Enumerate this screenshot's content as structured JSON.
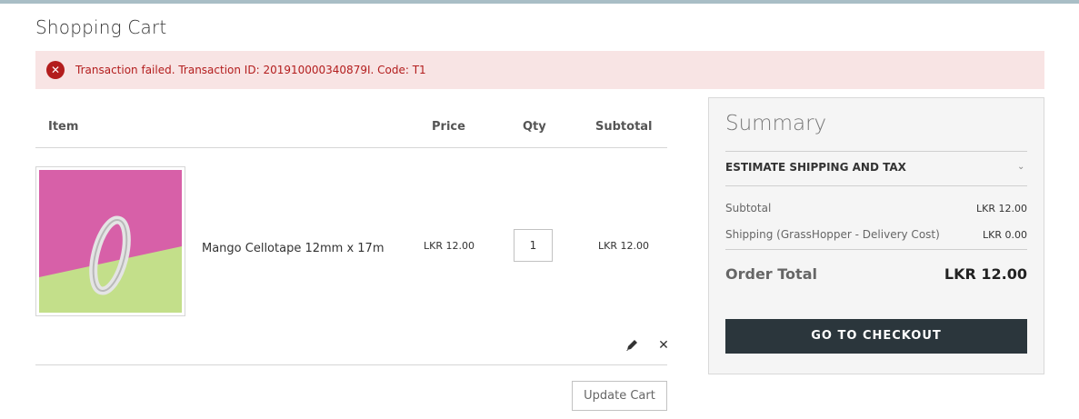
{
  "page": {
    "title": "Shopping Cart"
  },
  "alert": {
    "icon": "error-x-icon",
    "message": "Transaction failed. Transaction ID: 201910000340879I. Code: T1",
    "color": "#b31d1d",
    "background": "#f8e4e4"
  },
  "cart": {
    "columns": {
      "item": "Item",
      "price": "Price",
      "qty": "Qty",
      "subtotal": "Subtotal"
    },
    "items": [
      {
        "name": "Mango Cellotape 12mm x 17m",
        "price": "LKR 12.00",
        "qty": "1",
        "subtotal": "LKR 12.00",
        "edit_icon": "pencil-icon",
        "remove_icon": "close-icon",
        "remove_glyph": "✕"
      }
    ],
    "update_label": "Update Cart"
  },
  "summary": {
    "title": "Summary",
    "estimate_label": "ESTIMATE SHIPPING AND TAX",
    "chevron_icon": "chevron-down-icon",
    "chevron_glyph": "⌄",
    "subtotal_label": "Subtotal",
    "subtotal_value": "LKR 12.00",
    "shipping_label": "Shipping (GrassHopper - Delivery Cost)",
    "shipping_value": "LKR 0.00",
    "order_total_label": "Order Total",
    "order_total_value": "LKR 12.00",
    "checkout_label": "GO TO CHECKOUT",
    "checkout_color": "#2b363c"
  },
  "alert_glyph": "✕"
}
